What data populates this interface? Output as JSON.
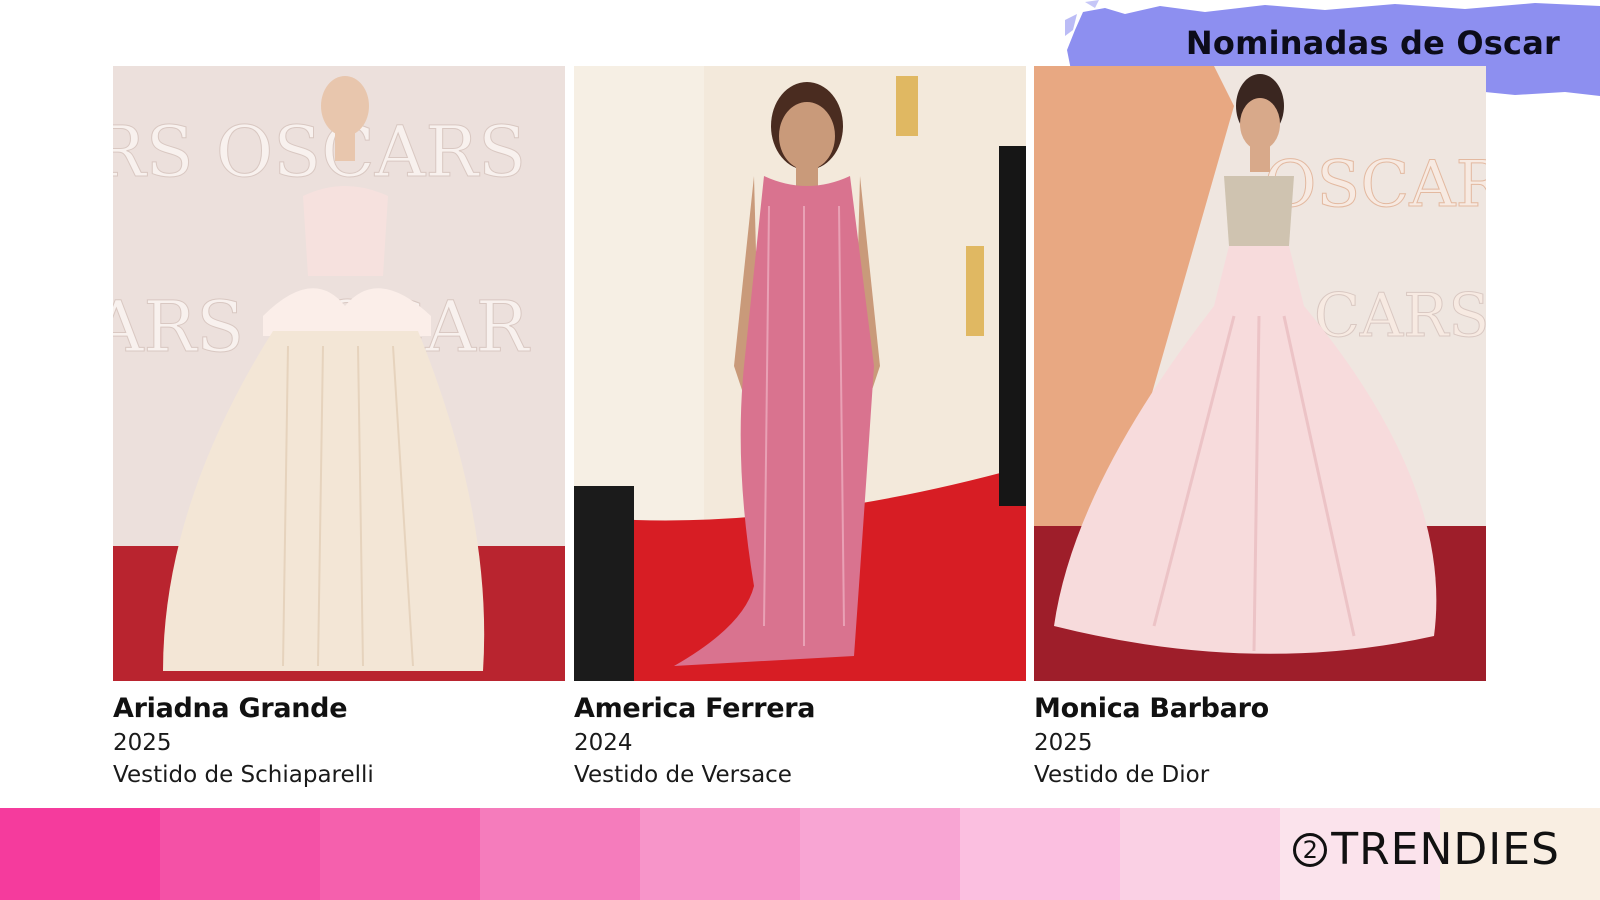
{
  "header": {
    "title": "Nominadas de Oscar",
    "badge_color": "#8d8ff0"
  },
  "cards": [
    {
      "name": "Ariadna Grande",
      "year": "2025",
      "designer": "Vestido de Schiaparelli",
      "photo_backdrop": "#efe3df",
      "carpet_color": "#b9242f",
      "dress_color": "#f3e6d6",
      "backdrop_text": "OSCARS"
    },
    {
      "name": "America Ferrera",
      "year": "2024",
      "designer": "Vestido de Versace",
      "photo_backdrop": "#f6efe4",
      "carpet_color": "#d71d24",
      "dress_color": "#d9738f",
      "backdrop_text": ""
    },
    {
      "name": "Monica Barbaro",
      "year": "2025",
      "designer": "Vestido de Dior",
      "photo_backdrop": "#efe6e0",
      "carpet_color": "#9e1e2a",
      "dress_color": "#f7dbdc",
      "backdrop_text": "OSCARS"
    }
  ],
  "palette": [
    "#f53b9d",
    "#f451a6",
    "#f560ad",
    "#f57cbc",
    "#f795c9",
    "#f8a5d3",
    "#fbbfe0",
    "#fad0e4",
    "#fbe3ec",
    "#f9eee2"
  ],
  "brand": {
    "mark": "2",
    "name": "TRENDIES"
  }
}
